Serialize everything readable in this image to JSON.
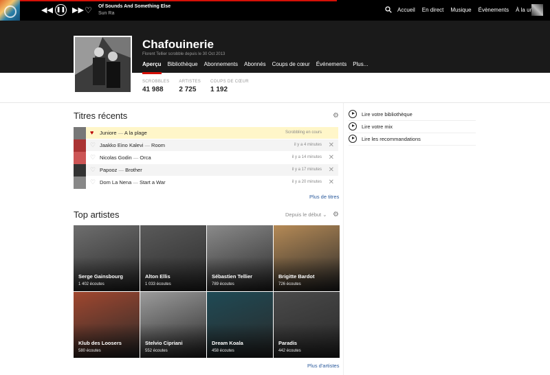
{
  "player": {
    "track": "Of Sounds And Something Else",
    "artist": "Sun Ra",
    "icons": {
      "prev": "rewind-icon",
      "play": "pause-icon",
      "next": "forward-icon",
      "love": "heart-icon"
    }
  },
  "nav": [
    "Accueil",
    "En direct",
    "Musique",
    "Évènements",
    "À la une"
  ],
  "profile": {
    "username": "Chafouinerie",
    "subtitle": "Florent Tellier scrobble depuis le 30 Oct 2013",
    "tabs": [
      "Aperçu",
      "Bibliothèque",
      "Abonnements",
      "Abonnés",
      "Coups de cœur",
      "Événements",
      "Plus..."
    ],
    "active_tab": 0
  },
  "stats": [
    {
      "label": "SCROBBLES",
      "value": "41 988"
    },
    {
      "label": "ARTISTES",
      "value": "2 725"
    },
    {
      "label": "COUPS DE CŒUR",
      "value": "1 192"
    }
  ],
  "recent": {
    "title": "Titres récents",
    "tracks": [
      {
        "artist": "Juniore",
        "title": "A la plage",
        "when": "Scrobbling en cours",
        "now": true,
        "thumb": "#777"
      },
      {
        "artist": "Jaakko Eino Kalevi",
        "title": "Room",
        "when": "il y a 4 minutes",
        "now": false,
        "thumb": "#a33"
      },
      {
        "artist": "Nicolas Godin",
        "title": "Orca",
        "when": "il y a 14 minutes",
        "now": false,
        "thumb": "#c55"
      },
      {
        "artist": "Papooz",
        "title": "Brother",
        "when": "il y a 17 minutes",
        "now": false,
        "thumb": "#333"
      },
      {
        "artist": "Dom La Nena",
        "title": "Start a War",
        "when": "il y a 20 minutes",
        "now": false,
        "thumb": "#888"
      }
    ],
    "more": "Plus de titres"
  },
  "play_options": [
    "Lire votre bibliothèque",
    "Lire votre mix",
    "Lire les recommandations"
  ],
  "top_artists": {
    "title": "Top artistes",
    "sort": "Depuis le début",
    "artists": [
      {
        "name": "Serge Gainsbourg",
        "plays": "1 402 écoutes",
        "bg": "#6e6e6e"
      },
      {
        "name": "Alton Ellis",
        "plays": "1 033 écoutes",
        "bg": "#5a5a5a"
      },
      {
        "name": "Sébastien Tellier",
        "plays": "789 écoutes",
        "bg": "#8a8a8a"
      },
      {
        "name": "Brigitte Bardot",
        "plays": "726 écoutes",
        "bg": "#b58a56"
      },
      {
        "name": "Klub des Loosers",
        "plays": "580 écoutes",
        "bg": "#a0472f"
      },
      {
        "name": "Stelvio Cipriani",
        "plays": "552 écoutes",
        "bg": "#9b9b9b"
      },
      {
        "name": "Dream Koala",
        "plays": "458 écoutes",
        "bg": "#1f4a55"
      },
      {
        "name": "Paradis",
        "plays": "442 écoutes",
        "bg": "#4a4a4a"
      }
    ],
    "more": "Plus d'artistes"
  }
}
